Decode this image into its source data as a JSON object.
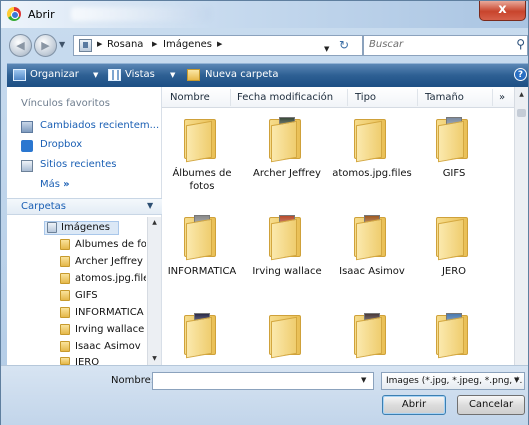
{
  "window": {
    "title": "Abrir",
    "close_glyph": "x"
  },
  "address": {
    "crumbs": [
      "Rosana",
      "Imágenes"
    ],
    "search_placeholder": "Buscar"
  },
  "toolbar": {
    "organize": "Organizar",
    "views": "Vistas",
    "new_folder": "Nueva carpeta",
    "help_glyph": "?"
  },
  "nav": {
    "favorites_heading": "Vínculos favoritos",
    "favorites": [
      {
        "label": "Cambiados recientem...",
        "icon": "recent-changes-icon"
      },
      {
        "label": "Dropbox",
        "icon": "dropbox-icon"
      },
      {
        "label": "Sitios recientes",
        "icon": "recent-places-icon"
      }
    ],
    "more": "Más",
    "folders_heading": "Carpetas",
    "tree": [
      {
        "label": "Imágenes",
        "selected": true
      },
      {
        "label": "Álbumes de fo"
      },
      {
        "label": "Archer Jeffrey"
      },
      {
        "label": "atomos.jpg.file"
      },
      {
        "label": "GIFS"
      },
      {
        "label": "INFORMATICA"
      },
      {
        "label": "Irving wallace"
      },
      {
        "label": "Isaac Asimov"
      },
      {
        "label": "JERO"
      }
    ]
  },
  "columns": [
    "Nombre",
    "Fecha modificación",
    "Tipo",
    "Tamaño"
  ],
  "columns_more": "»",
  "items": [
    {
      "label": "Álbumes de fotos",
      "icon": "folder-icon"
    },
    {
      "label": "Archer Jeffrey",
      "icon": "folder-icon",
      "preview_color": "#3a4a3a"
    },
    {
      "label": "atomos.jpg.files",
      "icon": "folder-icon"
    },
    {
      "label": "GIFS",
      "icon": "folder-icon",
      "preview_color": "#7a8aa0"
    },
    {
      "label": "INFORMATICA",
      "icon": "folder-icon",
      "preview_color": "#8a8a8a"
    },
    {
      "label": "Irving wallace",
      "icon": "folder-icon",
      "preview_color": "#b84a2a"
    },
    {
      "label": "Isaac Asimov",
      "icon": "folder-icon",
      "preview_color": "#a05a20"
    },
    {
      "label": "JERO",
      "icon": "folder-icon"
    },
    {
      "label": "",
      "icon": "folder-icon",
      "preview_color": "#2a2a4a"
    },
    {
      "label": "",
      "icon": "folder-icon"
    },
    {
      "label": "",
      "icon": "folder-icon",
      "preview_color": "#4a3a3a"
    },
    {
      "label": "",
      "icon": "folder-icon",
      "preview_color": "#4a7ab0"
    }
  ],
  "footer": {
    "name_label": "Nombre:",
    "name_value": "",
    "filter": "Images (*.jpg, *.jpeg, *.png, *.",
    "open": "Abrir",
    "cancel": "Cancelar"
  },
  "colors": {
    "toolbar": "#2d5f93",
    "link": "#1a5fb4",
    "folder": "#efcd6f"
  }
}
